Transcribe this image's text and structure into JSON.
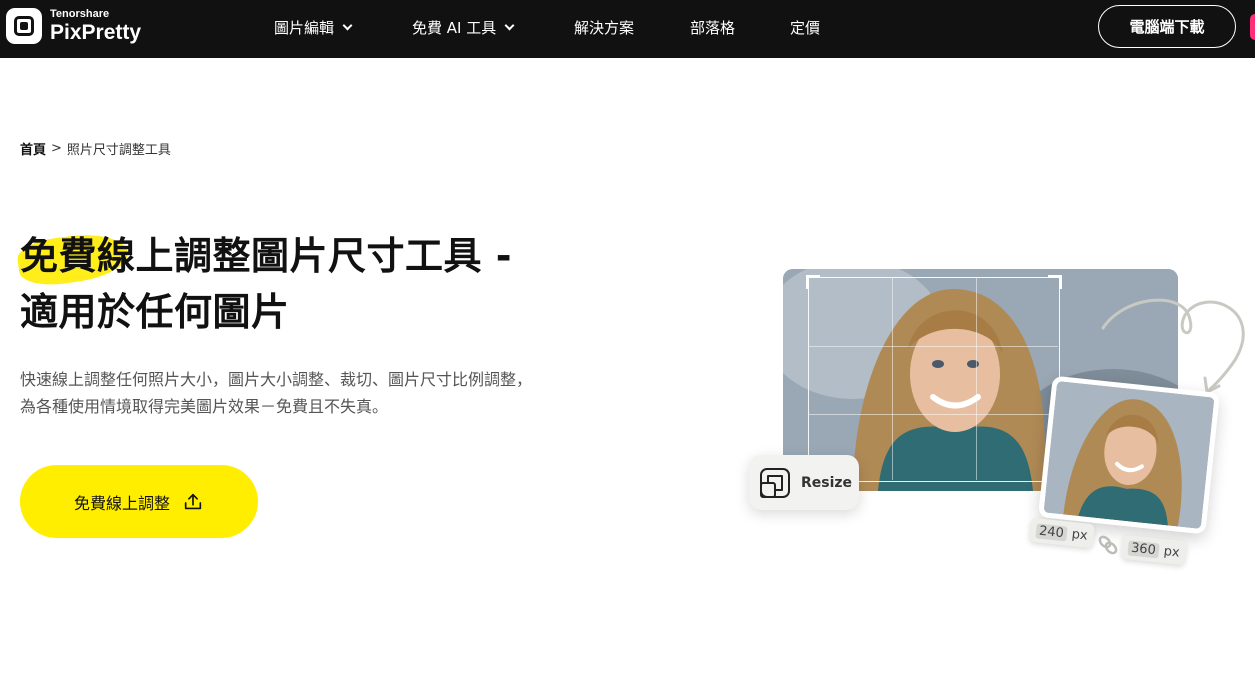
{
  "header": {
    "brand_sub": "Tenorshare",
    "brand_name": "PixPretty",
    "nav": [
      {
        "label": "圖片編輯",
        "has_dropdown": true
      },
      {
        "label": "免費 AI 工具",
        "has_dropdown": true
      },
      {
        "label": "解決方案",
        "has_dropdown": false
      },
      {
        "label": "部落格",
        "has_dropdown": false
      },
      {
        "label": "定價",
        "has_dropdown": false
      }
    ],
    "download_label": "電腦端下載"
  },
  "breadcrumb": {
    "home": "首頁",
    "separator": ">",
    "current": "照片尺寸調整工具"
  },
  "hero": {
    "title_line1": "免費線上調整圖片尺寸工具 -",
    "title_line2": "適用於任何圖片",
    "description": "快速線上調整任何照片大小，圖片大小調整、裁切、圖片尺寸比例調整，為各種使用情境取得完美圖片效果－免費且不失真。",
    "cta_label": "免費線上調整",
    "cta_icon": "upload-icon"
  },
  "visual": {
    "resize_label": "Resize",
    "width_value": "240",
    "height_value": "360",
    "unit": "px"
  },
  "colors": {
    "topbar": "#111111",
    "accent_yellow": "#ffee00"
  }
}
